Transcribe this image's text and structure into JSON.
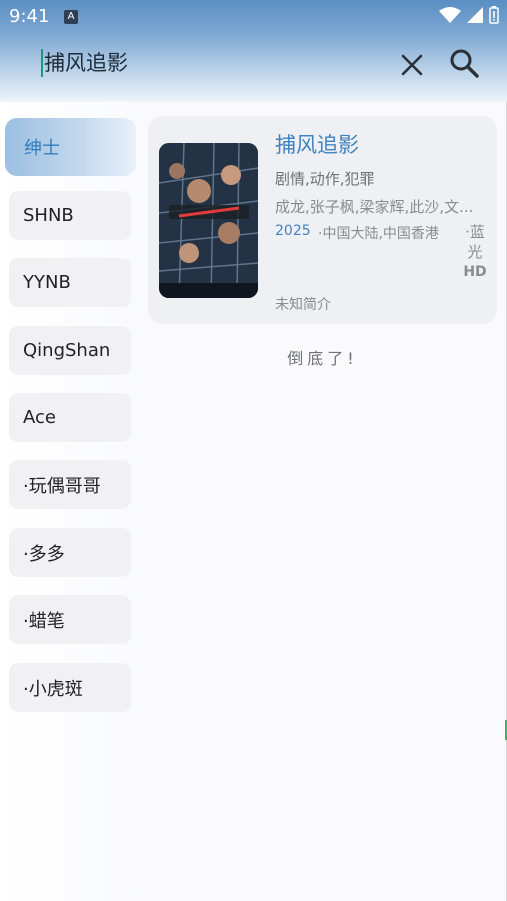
{
  "status_bar": {
    "time": "9:41",
    "a_badge": "A"
  },
  "search": {
    "query": "捕风追影"
  },
  "sidebar": {
    "items": [
      {
        "label": "绅士"
      },
      {
        "label": "SHNB"
      },
      {
        "label": "YYNB"
      },
      {
        "label": "QingShan"
      },
      {
        "label": "Ace"
      },
      {
        "label": "·玩偶哥哥"
      },
      {
        "label": "·多多"
      },
      {
        "label": "·蜡笔"
      },
      {
        "label": "·小虎斑"
      }
    ]
  },
  "result": {
    "title": "捕风追影",
    "genre": "剧情,动作,犯罪",
    "cast": "成龙,张子枫,梁家辉,此沙,文...",
    "year": "2025",
    "region": "·中国大陆,中国香港",
    "quality_line1": "·蓝",
    "quality_line2": "光",
    "quality_line3": "HD",
    "intro": "未知简介"
  },
  "end_text": "倒底了!",
  "colors": {
    "accent": "#3f82bf",
    "header_top": "#5a8fc3",
    "active_bg": "#9dbfe1"
  }
}
